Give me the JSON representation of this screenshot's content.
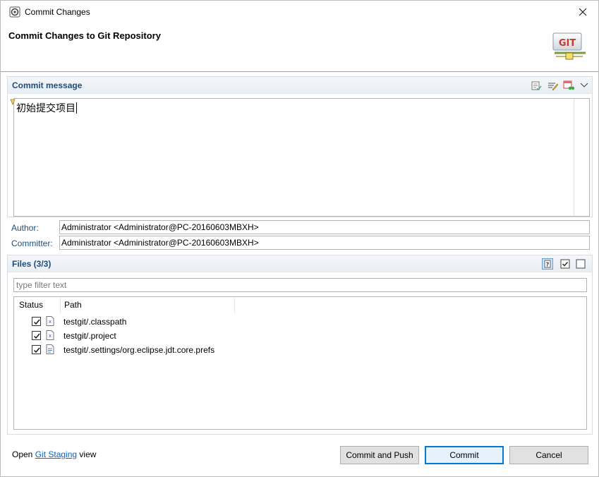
{
  "window": {
    "title": "Commit Changes"
  },
  "header": {
    "title": "Commit Changes to Git Repository",
    "logo_text": "GIT"
  },
  "commit_message": {
    "section_title": "Commit message",
    "text": "初始提交项目"
  },
  "author": {
    "label": "Author:",
    "value": "Administrator <Administrator@PC-20160603MBXH>"
  },
  "committer": {
    "label": "Committer:",
    "value": "Administrator <Administrator@PC-20160603MBXH>"
  },
  "files": {
    "section_title": "Files (3/3)",
    "filter_placeholder": "type filter text",
    "columns": [
      "Status",
      "Path"
    ],
    "rows": [
      {
        "checked": true,
        "icon": "xml-file-icon",
        "path": "testgit/.classpath"
      },
      {
        "checked": true,
        "icon": "xml-file-icon",
        "path": "testgit/.project"
      },
      {
        "checked": true,
        "icon": "text-file-icon",
        "path": "testgit/.settings/org.eclipse.jdt.core.prefs"
      }
    ]
  },
  "footer": {
    "open_text": "Open",
    "link_text": "Git Staging",
    "view_text": "view"
  },
  "buttons": {
    "commit_and_push": "Commit and Push",
    "commit": "Commit",
    "cancel": "Cancel"
  },
  "colors": {
    "accent": "#1f4d7a",
    "link": "#0066cc",
    "default_button_border": "#0078d7"
  }
}
